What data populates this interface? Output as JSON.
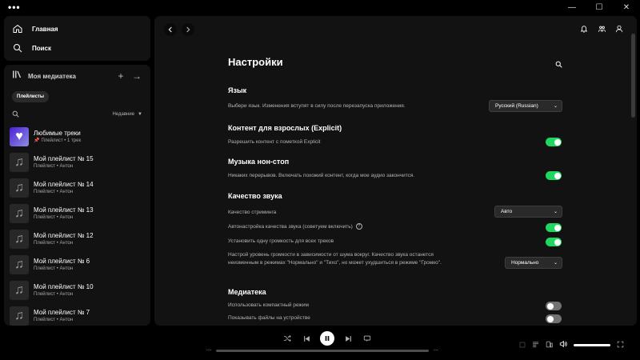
{
  "titlebar": {
    "menu_glyph": "•••",
    "min": "—",
    "max": "☐",
    "close": "✕"
  },
  "nav": {
    "home_label": "Главная",
    "search_label": "Поиск"
  },
  "library": {
    "title": "Моя медиатека",
    "chip": "Плейлисты",
    "sort_label": "Недавние",
    "items": [
      {
        "name": "Любимые треки",
        "sub": "Плейлист • 1 трек",
        "pinned": true
      },
      {
        "name": "Мой плейлист № 15",
        "sub": "Плейлист • Антон"
      },
      {
        "name": "Мой плейлист № 14",
        "sub": "Плейлист • Антон"
      },
      {
        "name": "Мой плейлист № 13",
        "sub": "Плейлист • Антон"
      },
      {
        "name": "Мой плейлист № 12",
        "sub": "Плейлист • Антон"
      },
      {
        "name": "Мой плейлист № 6",
        "sub": "Плейлист • Антон"
      },
      {
        "name": "Мой плейлист № 10",
        "sub": "Плейлист • Антон"
      },
      {
        "name": "Мой плейлист № 7",
        "sub": "Плейлист • Антон"
      }
    ]
  },
  "settings": {
    "title": "Настройки",
    "language": {
      "heading": "Язык",
      "desc": "Выбери язык. Изменения вступят в силу после перезапуска приложения.",
      "value": "Русский (Russian)"
    },
    "explicit": {
      "heading": "Контент для взрослых (Explicit)",
      "desc": "Разрешить контент с пометкой Explicit",
      "enabled": true
    },
    "nonstop": {
      "heading": "Музыка нон-стоп",
      "desc": "Никаких перерывов. Включать похожий контент, когда мое аудио закончится.",
      "enabled": true
    },
    "quality": {
      "heading": "Качество звука",
      "streaming_label": "Качество стриминга",
      "streaming_value": "Авто",
      "auto_label": "Автонастройка качества звука (советуем включить)",
      "auto_help": "?",
      "auto_enabled": true,
      "normalize_label": "Установить одну громкость для всех треков",
      "normalize_enabled": true,
      "level_label": "Настрой уровень громкости в зависимости от шума вокруг. Качество звука останется неизменным в режимах \"Нормально\" и \"Тихо\", но может ухудшиться в режиме \"Громко\".",
      "level_value": "Нормально"
    },
    "media": {
      "heading": "Медиатека",
      "compact_label": "Использовать компактный режим",
      "compact_enabled": false,
      "local_label": "Показывать файлы на устройстве",
      "local_enabled": false
    }
  },
  "player": {
    "elapsed": "-:--",
    "total": "-:--",
    "progress": 0,
    "volume": 1.0
  },
  "colors": {
    "accent": "#1ed760",
    "panel": "#121212",
    "background": "#000000"
  }
}
